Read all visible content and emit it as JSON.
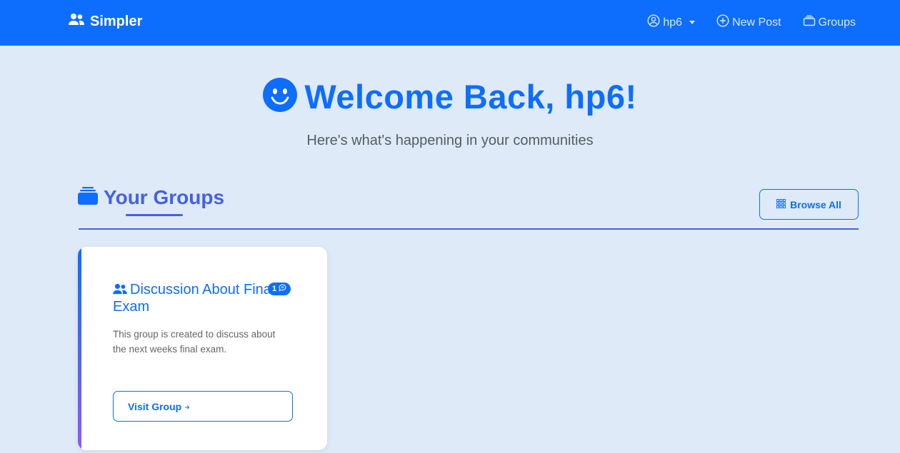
{
  "navbar": {
    "brand": "Simpler",
    "user_label": "hp6",
    "new_post_label": "New Post",
    "groups_label": "Groups",
    "bg_color": "#0d6efd"
  },
  "hero": {
    "title": "Welcome Back, hp6!",
    "subtitle": "Here's what's happening in your communities",
    "icon": "smile-icon"
  },
  "groups_section": {
    "title": "Your Groups",
    "browse_label": "Browse All",
    "accent_color": "#4461e5"
  },
  "groups": [
    {
      "title": "Discussion About Final Exam",
      "badge_count": "1",
      "description": "This group is created to discuss about the next weeks final exam.",
      "visit_label": "Visit Group"
    }
  ]
}
